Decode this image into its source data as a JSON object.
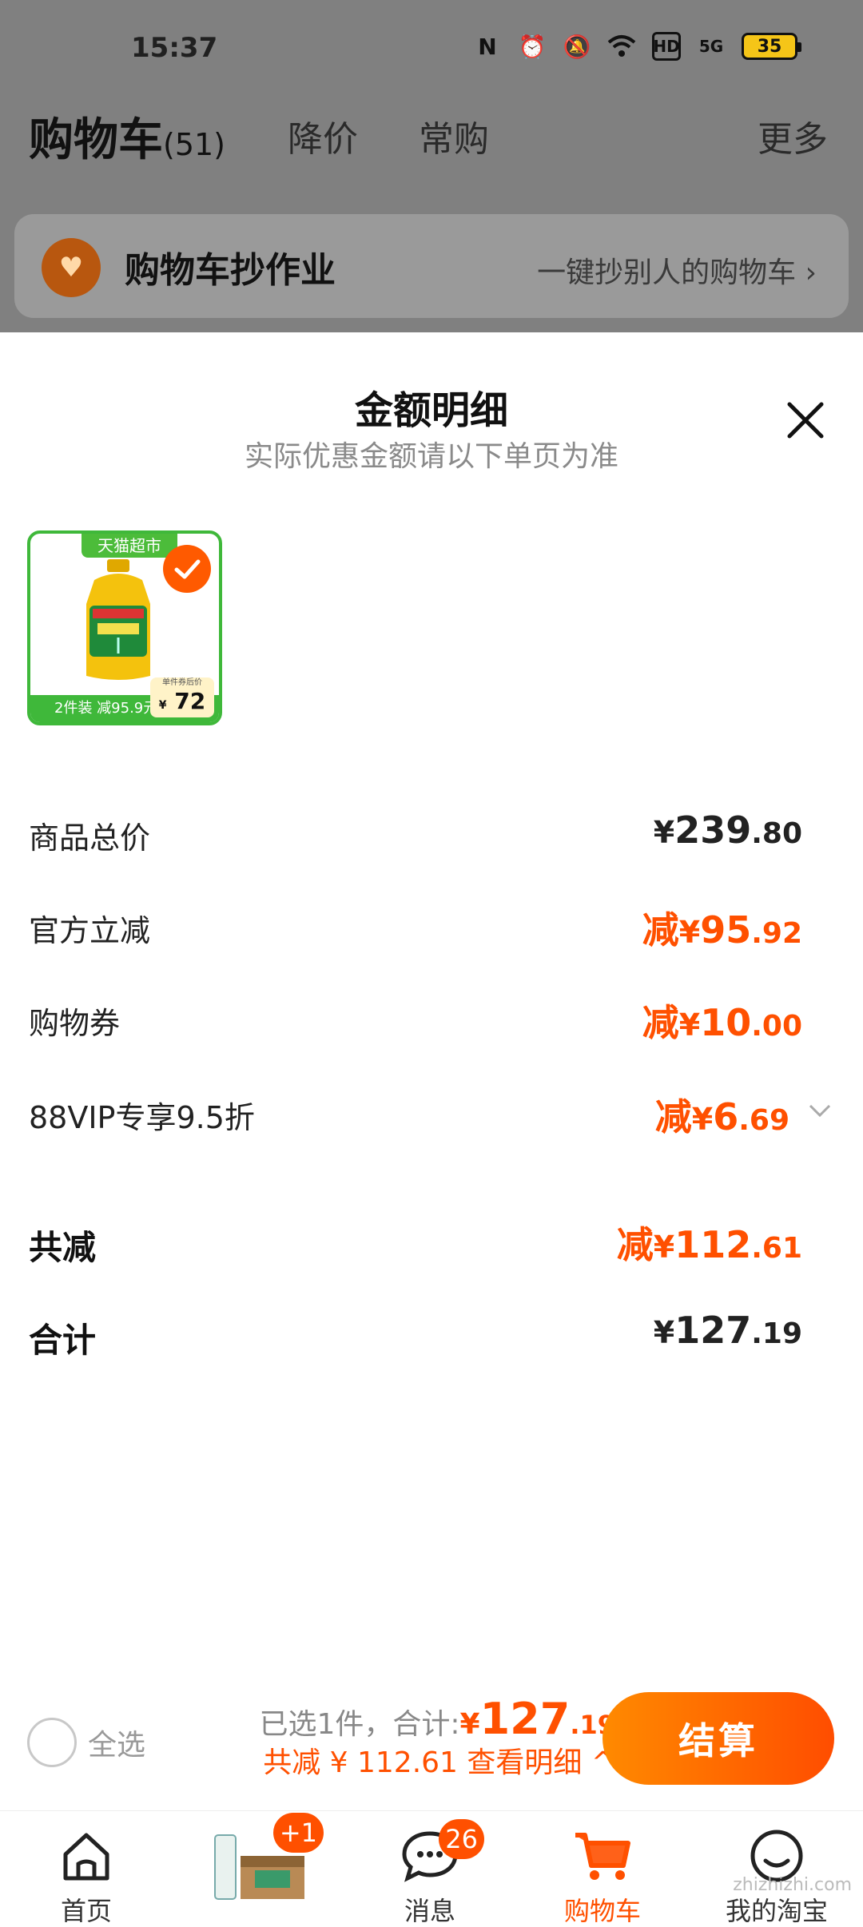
{
  "status_bar": {
    "time": "15:37",
    "battery": "35",
    "network": "5G",
    "hd": "HD"
  },
  "nav": {
    "cart_title": "购物车",
    "cart_count": "(51)",
    "tabs": [
      "降价",
      "常购"
    ],
    "more": "更多"
  },
  "banner": {
    "title": "购物车抄作业",
    "link": "一键抄别人的购物车 ›"
  },
  "sheet": {
    "title": "金额明细",
    "subtitle": "实际优惠金额请以下单页为准",
    "product": {
      "tag": "天猫超市",
      "promo": "2件装 减95.9元",
      "price_label": "单件券后价",
      "price_yen": "¥",
      "price": "72"
    },
    "rows": [
      {
        "label": "商品总价",
        "prefix": "",
        "yen": "¥",
        "int": "239",
        "dec": ".80",
        "color": "#222222"
      },
      {
        "label": "官方立减",
        "prefix": "减",
        "yen": "¥",
        "int": "95",
        "dec": ".92",
        "color": "#ff5000"
      },
      {
        "label": "购物券",
        "prefix": "减",
        "yen": "¥",
        "int": "10",
        "dec": ".00",
        "color": "#ff5000"
      },
      {
        "label": "88VIP专享9.5折",
        "prefix": "减",
        "yen": "¥",
        "int": "6",
        "dec": ".69",
        "color": "#ff5000"
      }
    ],
    "total_discount": {
      "label": "共减",
      "prefix": "减",
      "yen": "¥",
      "int": "112",
      "dec": ".61"
    },
    "total": {
      "label": "合计",
      "yen": "¥",
      "int": "127",
      "dec": ".19"
    }
  },
  "checkout": {
    "select_all": "全选",
    "selected_text": "已选1件，合计:",
    "total_yen": "¥",
    "total_int": "127",
    "total_dec": ".19",
    "discount_text": "共减 ¥ 112.61 查看明细 ^",
    "pay_button": "结算"
  },
  "tabbar": {
    "tabs": [
      {
        "label": "首页",
        "icon": "home-icon"
      },
      {
        "label": "",
        "icon": "promo-product-icon",
        "badge": "+1"
      },
      {
        "label": "消息",
        "icon": "message-icon",
        "badge": "26"
      },
      {
        "label": "购物车",
        "icon": "cart-icon"
      },
      {
        "label": "我的淘宝",
        "icon": "profile-icon"
      }
    ],
    "watermark": "zhizhizhi.com"
  },
  "colors": {
    "accent": "#ff5000",
    "green_tag": "#3fb83a"
  }
}
